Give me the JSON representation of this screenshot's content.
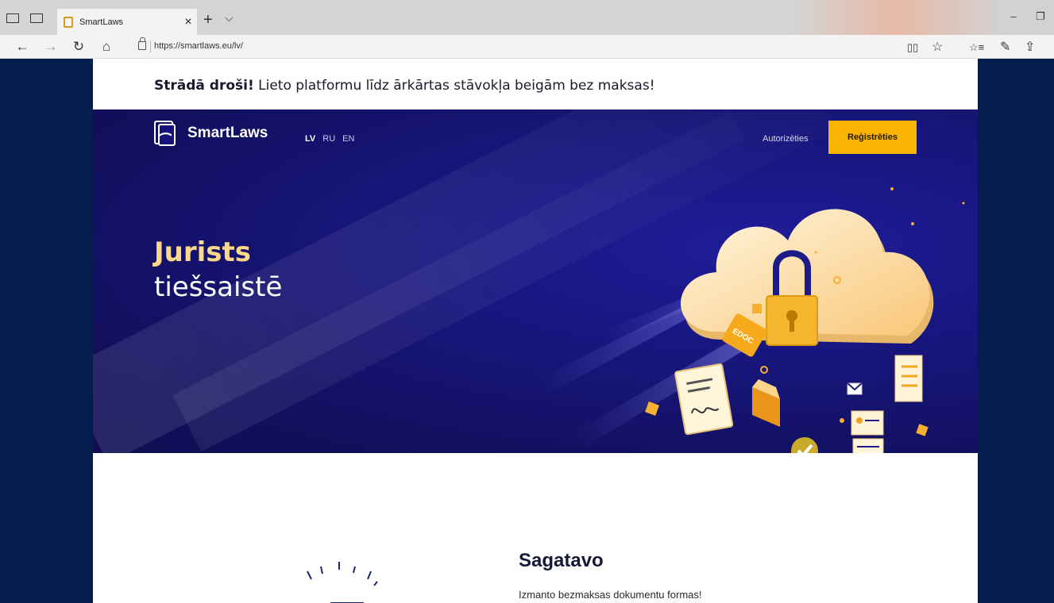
{
  "browser": {
    "tab_title": "SmartLaws",
    "tab_close": "×",
    "new_tab": "+",
    "tab_list": "⌵",
    "url": "https://smartlaws.eu/lv/",
    "back": "←",
    "forward": "→",
    "refresh": "↻",
    "home": "⌂",
    "reading_view": "📖",
    "favorite": "☆",
    "favorites_bar": "☆≡",
    "notes": "✎",
    "share": "⇪",
    "minimize": "–",
    "restore": "❐"
  },
  "banner": {
    "bold": "Strādā droši!",
    "text": " Lieto platformu līdz ārkārtas stāvokļa beigām bez maksas!"
  },
  "header": {
    "logo": "SmartLaws",
    "languages": [
      "LV",
      "RU",
      "EN"
    ],
    "login": "Autorizēties",
    "register": "Reģistrēties"
  },
  "hero": {
    "title_line1": "Jurists",
    "title_line2": "tiešsaistē",
    "edoc_label": "EDOC"
  },
  "section": {
    "title": "Sagatavo",
    "text": "Izmanto bezmaksas dokumentu formas!"
  },
  "colors": {
    "accent": "#f8b400",
    "hero_bg": "#17157a",
    "side_bg": "#041c4e",
    "title_highlight": "#fbd88a"
  }
}
